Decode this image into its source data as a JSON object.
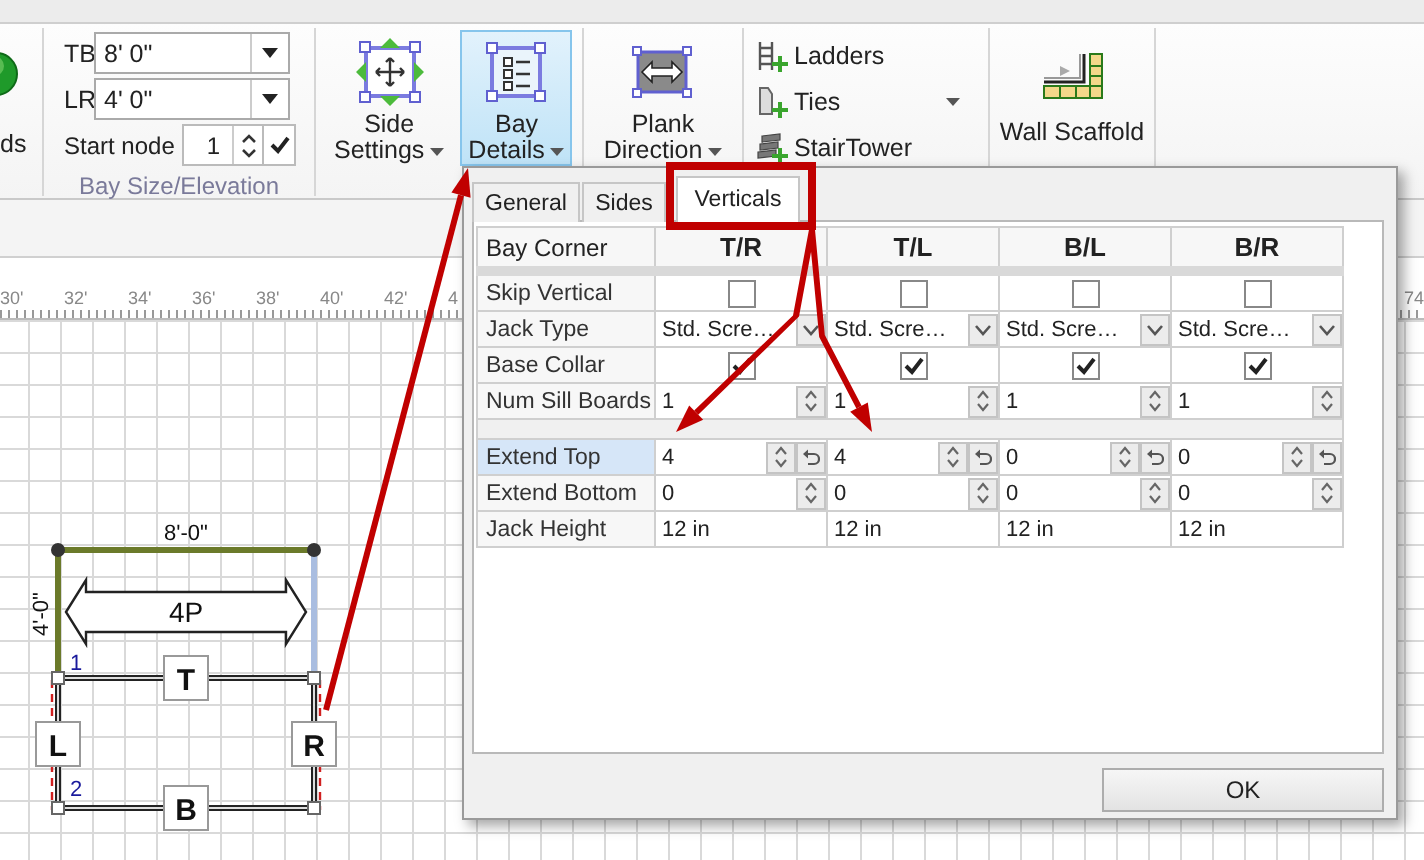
{
  "ribbon": {
    "cut_button": {
      "label": "ds"
    },
    "bay_size": {
      "title": "Bay Size/Elevation",
      "fields": [
        {
          "label": "TB",
          "value": "8' 0\""
        },
        {
          "label": "LR",
          "value": "4' 0\""
        }
      ],
      "start_node": {
        "label": "Start node",
        "value": "1"
      }
    },
    "groups": [
      {
        "kind": "large",
        "buttons": [
          {
            "kind": "side",
            "lines": [
              "Side",
              "Settings"
            ],
            "selected": false,
            "dropdown": true
          },
          {
            "kind": "bay",
            "lines": [
              "Bay",
              "Details"
            ],
            "selected": true,
            "dropdown": true
          }
        ]
      },
      {
        "kind": "large",
        "buttons": [
          {
            "kind": "plank",
            "lines": [
              "Plank",
              "Direction"
            ],
            "selected": false,
            "dropdown": true
          }
        ]
      },
      {
        "kind": "small",
        "buttons": [
          {
            "kind": "ladders",
            "label": "Ladders",
            "dropdown": false
          },
          {
            "kind": "ties",
            "label": "Ties",
            "dropdown": true
          },
          {
            "kind": "stair",
            "label": "StairTower",
            "dropdown": false
          }
        ]
      },
      {
        "kind": "large",
        "buttons": [
          {
            "kind": "wall",
            "lines": [
              "Wall Scaffold"
            ],
            "selected": false,
            "dropdown": false
          }
        ]
      }
    ]
  },
  "ruler": {
    "labels": [
      "30'",
      "32'",
      "34'",
      "36'",
      "38'",
      "40'",
      "42'",
      "4"
    ],
    "cut_label": "74"
  },
  "drawing": {
    "top_dimension": "8'-0\"",
    "side_dimension": "4'-0\"",
    "plank_label": "4P",
    "side_labels": [
      "T",
      "L",
      "R",
      "B"
    ],
    "node_numbers": [
      "1",
      "2"
    ]
  },
  "dialog": {
    "tabs": [
      {
        "label": "General",
        "selected": false
      },
      {
        "label": "Sides",
        "selected": false
      },
      {
        "label": "Verticals",
        "selected": true
      }
    ],
    "table": {
      "columns": [
        "Bay Corner",
        "T/R",
        "T/L",
        "B/L",
        "B/R"
      ],
      "rows": [
        {
          "label": "Skip Vertical",
          "kind": "checkbox",
          "selected": false,
          "cells": [
            {
              "checked": false
            },
            {
              "checked": false
            },
            {
              "checked": false
            },
            {
              "checked": false
            }
          ]
        },
        {
          "label": "Jack Type",
          "kind": "dropdown",
          "selected": false,
          "cells": [
            {
              "value": "Std. Scre…"
            },
            {
              "value": "Std. Scre…"
            },
            {
              "value": "Std. Scre…"
            },
            {
              "value": "Std. Scre…"
            }
          ]
        },
        {
          "label": "Base Collar",
          "kind": "checkbox",
          "selected": false,
          "cells": [
            {
              "checked": true
            },
            {
              "checked": true
            },
            {
              "checked": true
            },
            {
              "checked": true
            }
          ]
        },
        {
          "label": "Num Sill Boards",
          "kind": "spin",
          "selected": false,
          "cells": [
            {
              "value": "1"
            },
            {
              "value": "1"
            },
            {
              "value": "1"
            },
            {
              "value": "1"
            }
          ]
        },
        {
          "kind": "spacer",
          "selected": false
        },
        {
          "label": "Extend Top",
          "kind": "spin_reset",
          "selected": true,
          "cells": [
            {
              "value": "4"
            },
            {
              "value": "4"
            },
            {
              "value": "0"
            },
            {
              "value": "0"
            }
          ]
        },
        {
          "label": "Extend Bottom",
          "kind": "spin",
          "selected": false,
          "cells": [
            {
              "value": "0"
            },
            {
              "value": "0"
            },
            {
              "value": "0"
            },
            {
              "value": "0"
            }
          ]
        },
        {
          "label": "Jack Height",
          "kind": "text",
          "selected": false,
          "cells": [
            {
              "value": "12 in"
            },
            {
              "value": "12 in"
            },
            {
              "value": "12 in"
            },
            {
              "value": "12 in"
            }
          ]
        }
      ]
    },
    "ok_button": "OK"
  }
}
